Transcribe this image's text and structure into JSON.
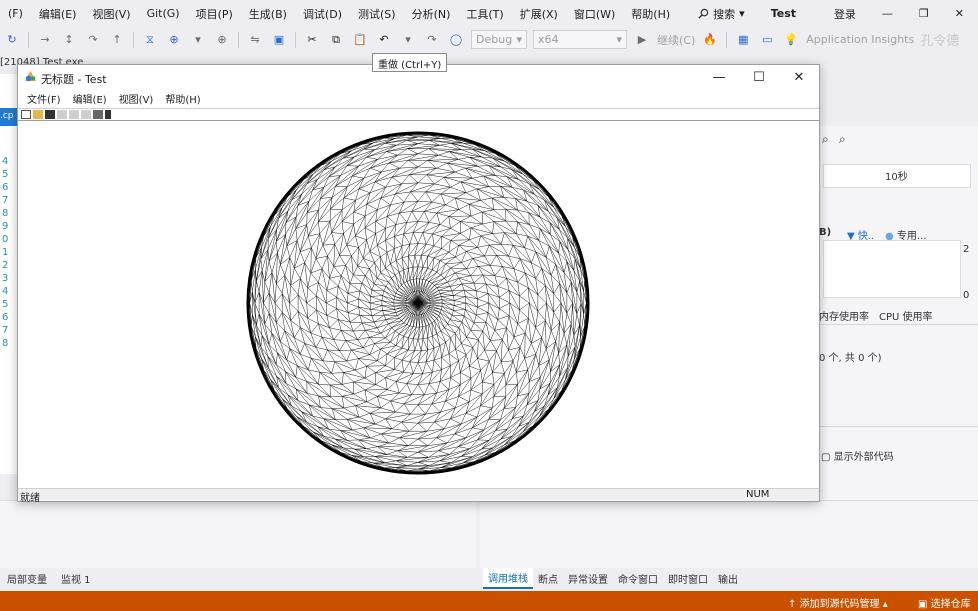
{
  "vs": {
    "menu": [
      "(F)",
      "编辑(E)",
      "视图(V)",
      "Git(G)",
      "项目(P)",
      "生成(B)",
      "调试(D)",
      "测试(S)",
      "分析(N)",
      "工具(T)",
      "扩展(X)",
      "窗口(W)",
      "帮助(H)"
    ],
    "search_label": "搜索",
    "solution_name": "Test",
    "login_label": "登录",
    "toolbar": {
      "config": "Debug",
      "platform": "x64",
      "continue_label": "继续(C)",
      "insights_label": "Application Insights",
      "watermark": "孔令德"
    },
    "tooltip": "重做 (Ctrl+Y)",
    "process_label": "[21048] Test.exe",
    "line_numbers": [
      "4",
      "5",
      "6",
      "7",
      "8",
      "9",
      "0",
      "1",
      "2",
      "3",
      "4",
      "5",
      "6",
      "7",
      "8"
    ],
    "left_tab_label": ".cp",
    "diagnostics": {
      "time_label": "10秒",
      "legend_fast": "快..",
      "legend_dedicated": "专用...",
      "value_top": "2",
      "value_bottom": "0",
      "tab_memory": "内存使用率",
      "tab_cpu": "CPU 使用率",
      "events_label": "0 个, 共 0 个)",
      "show_external_code": "显示外部代码"
    },
    "bottom_left_tabs": [
      "局部变量",
      "监视 1"
    ],
    "bottom_right_tabs": [
      "调用堆栈",
      "断点",
      "异常设置",
      "命令窗口",
      "即时窗口",
      "输出"
    ],
    "status": {
      "add_source_control": "添加到源代码管理",
      "select_repo": "选择仓库"
    },
    "icons": {
      "search": "search-icon",
      "pin": "pin-icon",
      "minimize": "minimize-icon",
      "restore": "restore-icon",
      "close": "close-icon"
    }
  },
  "app": {
    "title": "无标题 - Test",
    "menu": [
      "文件(F)",
      "编辑(E)",
      "视图(V)",
      "帮助(H)"
    ],
    "status_ready": "就绪",
    "status_num": "NUM",
    "window_buttons": {
      "minimize": "—",
      "maximize": "☐",
      "close": "✕"
    },
    "drawing": {
      "shape": "wireframe sphere",
      "view": "top-down (polar)",
      "line_color": "#000000",
      "background": "#ffffff"
    }
  },
  "colors": {
    "vs_background": "#eeeef2",
    "vs_status_bar": "#ca5100",
    "vs_accent": "#0e70c0"
  }
}
